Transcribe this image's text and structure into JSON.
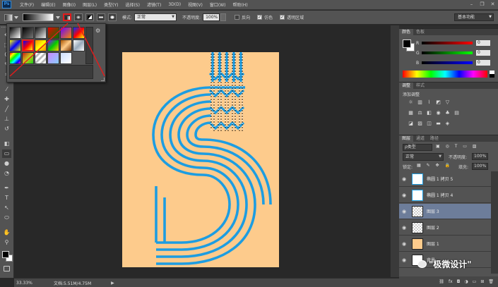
{
  "app": {
    "logo": "Ps"
  },
  "menubar": {
    "items": [
      "文件(F)",
      "编辑(E)",
      "图像(I)",
      "图层(L)",
      "类型(Y)",
      "选择(S)",
      "滤镜(T)",
      "3D(D)",
      "视图(V)",
      "窗口(W)",
      "帮助(H)"
    ],
    "minimize": "–",
    "restore": "❐",
    "close": "✕"
  },
  "options": {
    "mode_label": "模式:",
    "mode_value": "正常",
    "opacity_label": "不透明度:",
    "opacity_value": "100%",
    "reverse_label": "反向",
    "reverse_checked": false,
    "dither_label": "仿色",
    "dither_checked": true,
    "transparency_label": "透明区域",
    "transparency_checked": true,
    "workspace_value": "基本功能"
  },
  "gradient_picker": {
    "menu_icon": "gear-icon",
    "selected_index": 6,
    "highlight_color": "#e41b1b"
  },
  "toolbar": {
    "tools": [
      "move-icon",
      "marquee-icon",
      "lasso-icon",
      "quick-select-icon",
      "crop-icon",
      "eyedropper-icon",
      "healing-icon",
      "brush-icon",
      "clone-stamp-icon",
      "history-brush-icon",
      "eraser-icon",
      "gradient-icon",
      "blur-icon",
      "dodge-icon",
      "pen-icon",
      "type-icon",
      "path-select-icon",
      "shape-icon",
      "hand-icon",
      "zoom-icon"
    ],
    "type_glyph": "T"
  },
  "status": {
    "zoom": "33.33%",
    "doc_info": "文档:5.51M/4.75M",
    "arrow": "▶"
  },
  "color_panel": {
    "tabs": [
      "颜色",
      "色板"
    ],
    "sliders": [
      {
        "label": "R",
        "value": "0"
      },
      {
        "label": "G",
        "value": "0"
      },
      {
        "label": "B",
        "value": "0"
      }
    ]
  },
  "adjustments_panel": {
    "tabs": [
      "调整",
      "样式"
    ],
    "add_label": "添加调整"
  },
  "layers_panel": {
    "tabs": [
      "图层",
      "通道",
      "路径"
    ],
    "filter_label": "ρ类型",
    "blend_mode": "正常",
    "opacity_label": "不透明度:",
    "opacity_value": "100%",
    "lock_label": "锁定:",
    "fill_label": "填充:",
    "fill_value": "100%",
    "layers": [
      {
        "name": "椭圆 1 拷贝 5",
        "selected": false
      },
      {
        "name": "椭圆 1 拷贝 4",
        "selected": false
      },
      {
        "name": "图层 3",
        "selected": true
      },
      {
        "name": "图层 2",
        "selected": false
      },
      {
        "name": "图层 1",
        "selected": false
      },
      {
        "name": "背景",
        "selected": false
      }
    ],
    "bottom_icons": [
      "link-icon",
      "fx-icon",
      "mask-icon",
      "adjustment-icon",
      "group-icon",
      "new-layer-icon",
      "trash-icon"
    ]
  },
  "canvas": {
    "background_color": "#fdcb8c",
    "stroke_color": "#1d9de1"
  },
  "watermark": {
    "text": "\"极微设计\""
  }
}
